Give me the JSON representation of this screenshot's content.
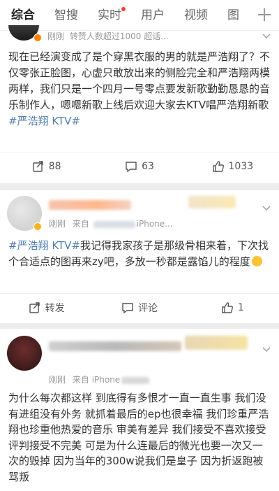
{
  "tabs": [
    "综合",
    "智搜",
    "实时",
    "用户",
    "视频",
    "图"
  ],
  "posts": [
    {
      "time": "刚刚",
      "note": "转赞人数超过1000 超话...",
      "text": "现在已经演变成了是个穿黑衣服的男的就是严浩翔了？不仅零张正脸图，心虚只敢放出来的侧脸完全和严浩翔两模两样，我们只是一个四月一号零点要发新歌勤勤恳恳的音乐制作人，嗯嗯新歌上线后欢迎大家去KTV唱严浩翔新歌",
      "hashtag": "#严浩翔 KTV#",
      "reposts": "88",
      "comments": "63",
      "likes": "1033"
    },
    {
      "time": "刚刚",
      "source": "来自",
      "device": "iPhone...",
      "hashtag": "#严浩翔 KTV#",
      "text": "我记得我家孩子是那级骨相来着，下次找个合适点的图再来zy吧，多放一秒都是露馅儿的程度",
      "reposts": "转发",
      "comments": "评论",
      "likes": "1"
    },
    {
      "time": "刚刚",
      "source": "来自",
      "device": "iPhone",
      "text": "为什么每次都这样 到底得有多恨才一直一直生事 我们没有进组没有外务 就抓着最后的ep也很幸福 我们珍重严浩翔也珍重他热爱的音乐 审美有差异 我们接受不喜欢接受评判接受不完美 可是为什么连最后的微光也要一次又一次的毁掉 因为当年的300w说我们是皇子 因为折返跑被骂叛"
    }
  ]
}
